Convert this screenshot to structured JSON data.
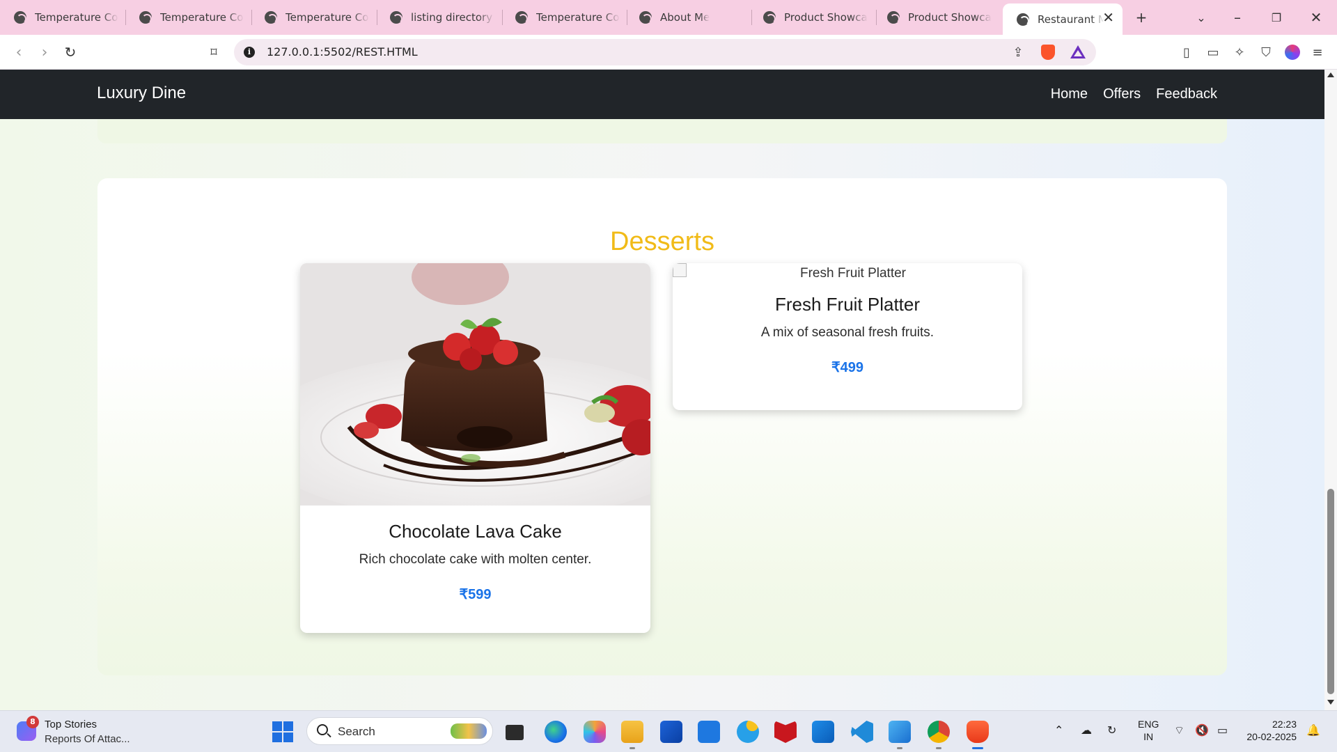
{
  "browser": {
    "tabs": [
      {
        "title": "Temperature Con"
      },
      {
        "title": "Temperature Con"
      },
      {
        "title": "Temperature Con"
      },
      {
        "title": "listing directory /"
      },
      {
        "title": "Temperature Con"
      },
      {
        "title": "About Me"
      },
      {
        "title": "Product Showcas"
      },
      {
        "title": "Product Showcas"
      },
      {
        "title": "Restaurant M"
      }
    ],
    "active_tab_index": 8,
    "url": "127.0.0.1:5502/REST.HTML",
    "icons": {
      "back": "arrow-left-icon",
      "forward": "arrow-right-icon",
      "reload": "reload-icon",
      "bookmark": "bookmark-icon",
      "share": "share-icon",
      "shield": "brave-shield-icon",
      "rewards": "brave-rewards-icon",
      "sidebar": "sidebar-icon",
      "wallet": "wallet-icon",
      "leo": "leo-ai-icon",
      "vpn": "vpn-icon",
      "menu": "hamburger-menu-icon"
    }
  },
  "site": {
    "brand": "Luxury Dine",
    "nav": [
      "Home",
      "Offers",
      "Feedback"
    ],
    "section_title": "Desserts",
    "items": [
      {
        "name": "Chocolate Lava Cake",
        "description": "Rich chocolate cake with molten center.",
        "price": "₹599",
        "image_alt": "Chocolate Lava Cake"
      },
      {
        "name": "Fresh Fruit Platter",
        "description": "A mix of seasonal fresh fruits.",
        "price": "₹499",
        "image_alt": "Fresh Fruit Platter"
      }
    ],
    "colors": {
      "navbar": "#212529",
      "section_title": "#f1bb18",
      "price": "#1a73e8"
    }
  },
  "taskbar": {
    "news_badge": "8",
    "news_title": "Top Stories",
    "news_subtitle": "Reports Of Attac...",
    "search_label": "Search",
    "language_top": "ENG",
    "language_bottom": "IN",
    "time": "22:23",
    "date": "20-02-2025"
  }
}
